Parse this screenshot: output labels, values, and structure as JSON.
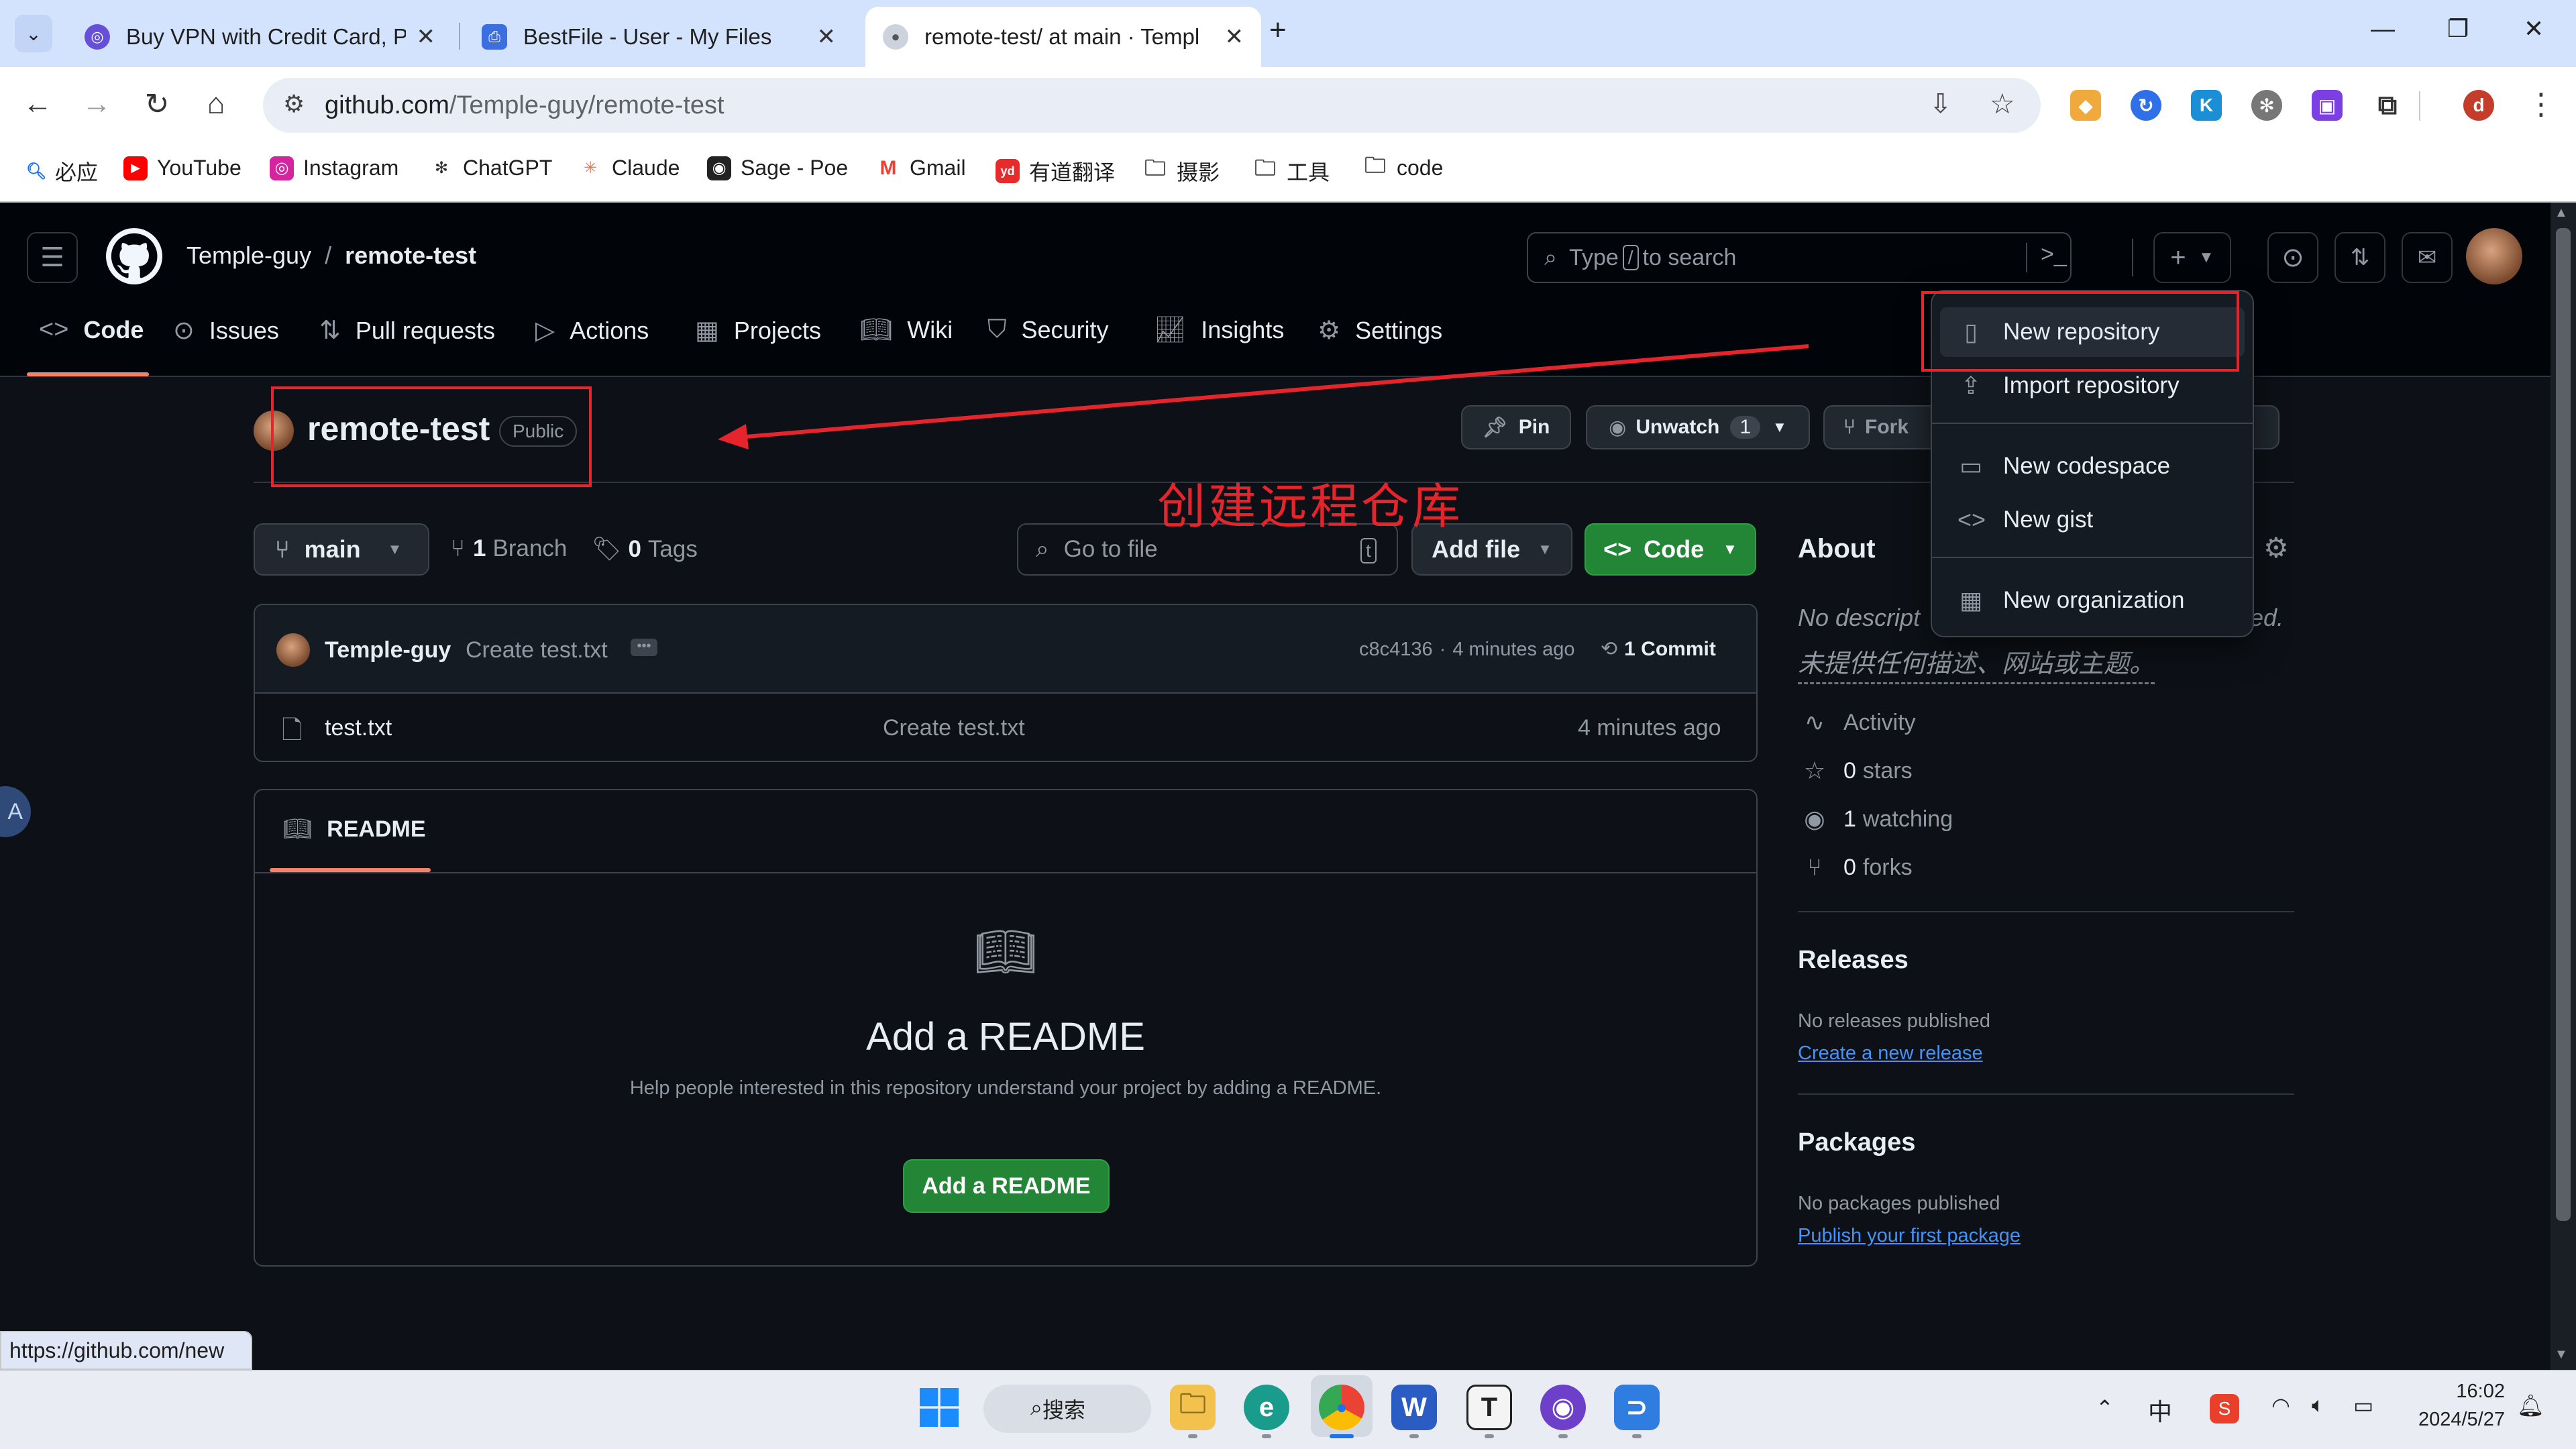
{
  "browser": {
    "tabs": [
      {
        "title": "Buy VPN with Credit Card, Pa",
        "icon": "vpn-favicon"
      },
      {
        "title": "BestFile - User - My Files",
        "icon": "bestfile-favicon"
      },
      {
        "title": "remote-test/ at main · Templ",
        "icon": "github-favicon"
      }
    ],
    "address": {
      "host": "github.com",
      "path": "/Temple-guy/remote-test"
    },
    "bookmarks": [
      "必应",
      "YouTube",
      "Instagram",
      "ChatGPT",
      "Claude",
      "Sage - Poe",
      "Gmail",
      "有道翻译",
      "摄影",
      "工具",
      "code"
    ],
    "profile_initial": "d",
    "status_url": "https://github.com/new"
  },
  "header": {
    "owner": "Temple-guy",
    "separator": "/",
    "repo": "remote-test",
    "search_prefix": "Type",
    "search_key": "/",
    "search_suffix": "to search"
  },
  "nav": {
    "tabs": [
      "Code",
      "Issues",
      "Pull requests",
      "Actions",
      "Projects",
      "Wiki",
      "Security",
      "Insights",
      "Settings"
    ]
  },
  "repo": {
    "name": "remote-test",
    "visibility": "Public",
    "pin_label": "Pin",
    "unwatch_label": "Unwatch",
    "watch_count": "1",
    "fork_label": "Fork",
    "branch": "main",
    "branch_count": "1",
    "branch_label": "Branch",
    "tag_count": "0",
    "tag_label": "Tags",
    "go_to_file": "Go to file",
    "go_to_file_key": "t",
    "add_file": "Add file",
    "code_button": "Code"
  },
  "commit": {
    "author": "Temple-guy",
    "message": "Create test.txt",
    "hash": "c8c4136",
    "dot": "·",
    "time": "4 minutes ago",
    "count_label": "1 Commit"
  },
  "files": [
    {
      "name": "test.txt",
      "message": "Create test.txt",
      "time": "4 minutes ago"
    }
  ],
  "readme": {
    "tab": "README",
    "heading": "Add a README",
    "help": "Help people interested in this repository understand your project by adding a README.",
    "button": "Add a README"
  },
  "about": {
    "title": "About",
    "description_en_start": "No descript",
    "description_en_end": "ed.",
    "description_zh": "未提供任何描述、网站或主题。",
    "stats": [
      {
        "label": "Activity"
      },
      {
        "count": "0",
        "label": "stars"
      },
      {
        "count": "1",
        "label": "watching"
      },
      {
        "count": "0",
        "label": "forks"
      }
    ]
  },
  "releases": {
    "title": "Releases",
    "none": "No releases published",
    "link": "Create a new release"
  },
  "packages": {
    "title": "Packages",
    "none": "No packages published",
    "link": "Publish your first package"
  },
  "menu": {
    "items": [
      "New repository",
      "Import repository",
      "New codespace",
      "New gist",
      "New organization"
    ]
  },
  "annotation": {
    "text": "创建远程仓库",
    "color": "#e5242b"
  },
  "taskbar": {
    "search": "搜索",
    "ime": "中",
    "time": "16:02",
    "date": "2024/5/27"
  },
  "colors": {
    "accent_green": "#238636",
    "link": "#4493f8",
    "tab_underline": "#f78166"
  }
}
